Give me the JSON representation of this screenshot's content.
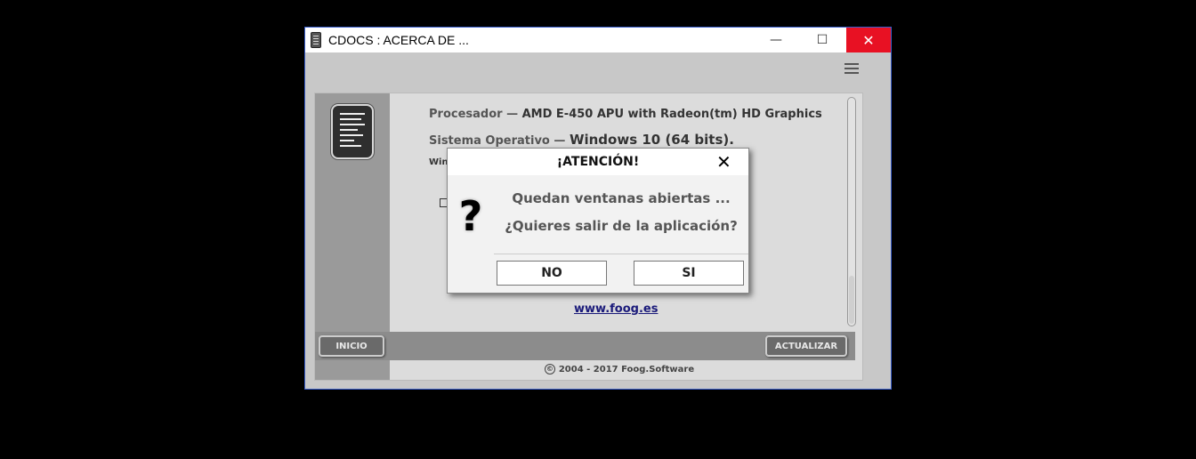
{
  "window": {
    "title": "CDOCS : ACERCA DE ...",
    "minimize_glyph": "—",
    "maximize_glyph": "☐",
    "close_glyph": "✕"
  },
  "content": {
    "cut_row_partial": "· ·",
    "processor_label": "Procesador —",
    "processor_value": "AMD E-450 APU with Radeon(tm) HD Graphics",
    "os_label": "Sistema Operativo —",
    "os_value": "Windows 10 (64 bits).",
    "small_row": "Win",
    "link": "www.foog.es"
  },
  "bottombar": {
    "inicio": "INICIO",
    "actualizar": "ACTUALIZAR"
  },
  "footer": {
    "copyright_symbol": "©",
    "text": "2004 - 2017 Foog.Software"
  },
  "dialog": {
    "title": "¡ATENCIÓN!",
    "close_glyph": "✕",
    "icon_glyph": "?",
    "message_line1": "Quedan ventanas abiertas ...",
    "message_line2": "¿Quieres salir de la aplicación?",
    "no_label": "NO",
    "si_label": "SI"
  },
  "colors": {
    "close_button": "#e81123",
    "window_border": "#3a5fcd",
    "link": "#1a1a7a"
  },
  "icons": [
    "app-icon",
    "minimize-icon",
    "maximize-icon",
    "close-icon",
    "hamburger-menu-icon",
    "document-icon",
    "monitor-icon",
    "copyright-icon",
    "question-icon"
  ]
}
